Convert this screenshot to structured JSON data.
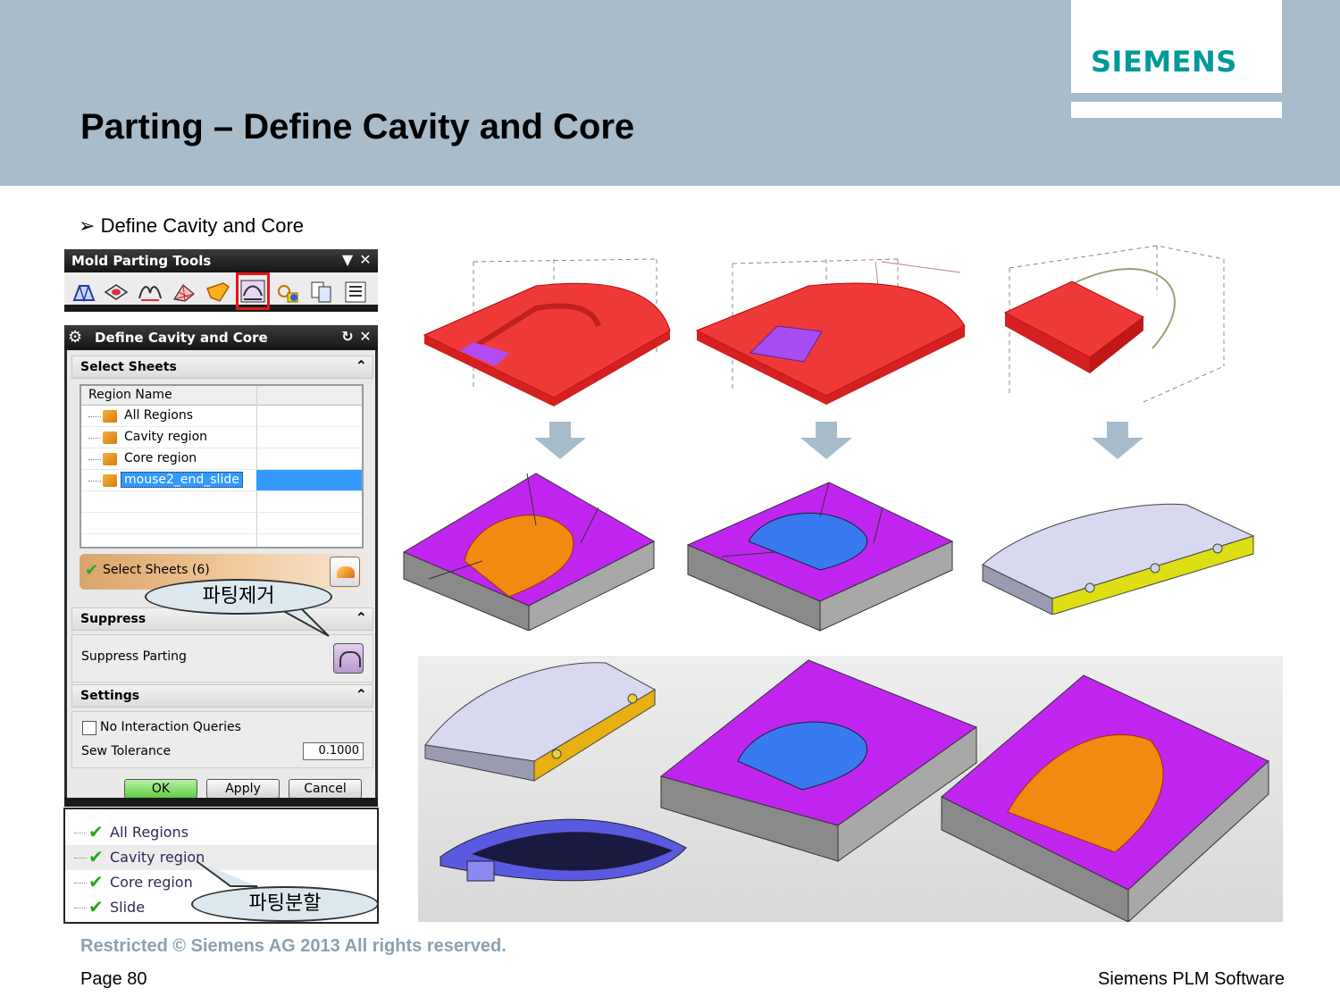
{
  "header": {
    "logo": "SIEMENS",
    "title": "Parting – Define Cavity and Core"
  },
  "bullet": {
    "marker": "➢",
    "text": "Define Cavity and Core"
  },
  "toolbar": {
    "title": "Mold Parting Tools",
    "dropdown_glyph": "▼",
    "close_glyph": "✕",
    "icons": [
      "region-analysis-icon",
      "design-region-icon",
      "parting-lines-icon",
      "guide-line-icon",
      "parting-surface-icon",
      "define-cavity-core-icon",
      "trans-swap-icon",
      "copy-icon",
      "navigator-icon"
    ]
  },
  "dialog": {
    "title": "Define Cavity and Core",
    "reset_glyph": "↻",
    "close_glyph": "✕",
    "select_sheets_section": "Select Sheets",
    "column_header": "Region Name",
    "regions": [
      {
        "label": "All Regions",
        "selected": false
      },
      {
        "label": "Cavity region",
        "selected": false
      },
      {
        "label": "Core region",
        "selected": false
      },
      {
        "label": "mouse2_end_slide",
        "selected": true
      }
    ],
    "select_sheets_label": "Select Sheets (6)",
    "suppress_section": "Suppress",
    "suppress_parting_label": "Suppress Parting",
    "settings_section": "Settings",
    "no_interaction_label": "No Interaction Queries",
    "no_interaction_checked": false,
    "sew_tolerance_label": "Sew Tolerance",
    "sew_tolerance_value": "0.1000",
    "ok": "OK",
    "apply": "Apply",
    "cancel": "Cancel"
  },
  "callouts": {
    "remove_parting": "파팅제거",
    "split_parting": "파팅분할"
  },
  "result_tree": [
    "All Regions",
    "Cavity region",
    "Core region",
    "Slide"
  ],
  "colors": {
    "header_band": "#a9bccb",
    "logo": "#009999",
    "cavity_red": "#f03a3a",
    "plate_purple": "#c026f0",
    "core_orange": "#f08a10",
    "core_blue": "#3a7af0",
    "slide_yellow": "#dede14"
  },
  "footer": {
    "restricted": "Restricted © Siemens AG 2013 All rights reserved.",
    "page": "Page 80",
    "company": "Siemens PLM Software"
  }
}
